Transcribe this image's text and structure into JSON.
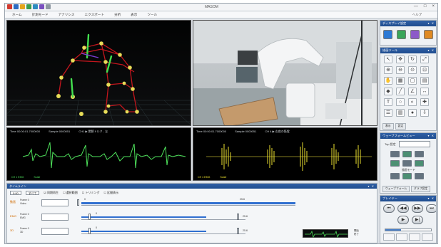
{
  "window": {
    "title": "MASOM",
    "controls": [
      "—",
      "□",
      "×"
    ]
  },
  "menu": {
    "items": [
      "ホーム",
      "計測モード",
      "アナリシス",
      "エクスポート",
      "分析",
      "表示",
      "ツール"
    ],
    "right_label": "ヘルプ"
  },
  "view3d": {},
  "camera": {},
  "emg_left": {
    "time": "Time 00:00:01.7000000",
    "sample": "Sample 0000051",
    "channel": "CH1 ▶ 関節トルク - 左"
  },
  "emg_right": {
    "time": "Time 00:00:01.7000000",
    "sample": "Sample 0000051",
    "channel": "CH 4 ▶ 右肩の筋電"
  },
  "side_panels": {
    "display_title": "ディスプレイ設定",
    "tools_title": "描画ツール",
    "tool_tabs": [
      "表示",
      "設定"
    ],
    "wave_title": "ウェーブフォームビュー",
    "wave_label": "Top 設定",
    "wave_mid": "描画モード",
    "wave_tabs": [
      "ウェーブフォーム",
      "グラフ設定"
    ],
    "player_title": "プレイヤー",
    "player_progress": 0.35,
    "player_buttons": [
      "⏮",
      "◀◀",
      "▶",
      "▶▶",
      "⏭"
    ]
  },
  "timeline": {
    "title": "タイムライン",
    "toolbar": {
      "field1": "0:00",
      "field2": "すべて",
      "check1": "☑ 同期再生",
      "check2": "☐ 選択範囲",
      "check3": "☐ トリミング",
      "check4": "☐ 区間表示"
    },
    "tracks": [
      {
        "name": "動画",
        "info1": "Frame 0",
        "info2": "Video",
        "val_start": "0",
        "val_end": "25.6",
        "progress": 1.0
      },
      {
        "name": "EMG",
        "info1": "Frame 0",
        "info2": "EMG",
        "val_start": "0",
        "val_end": "25.6",
        "progress": 0.76
      },
      {
        "name": "3D",
        "info1": "Frame 0",
        "info2": "3D",
        "val_start": "0",
        "val_end": "25.6",
        "progress": 0.76
      }
    ],
    "mini_labels": [
      "開始",
      "終了"
    ]
  }
}
